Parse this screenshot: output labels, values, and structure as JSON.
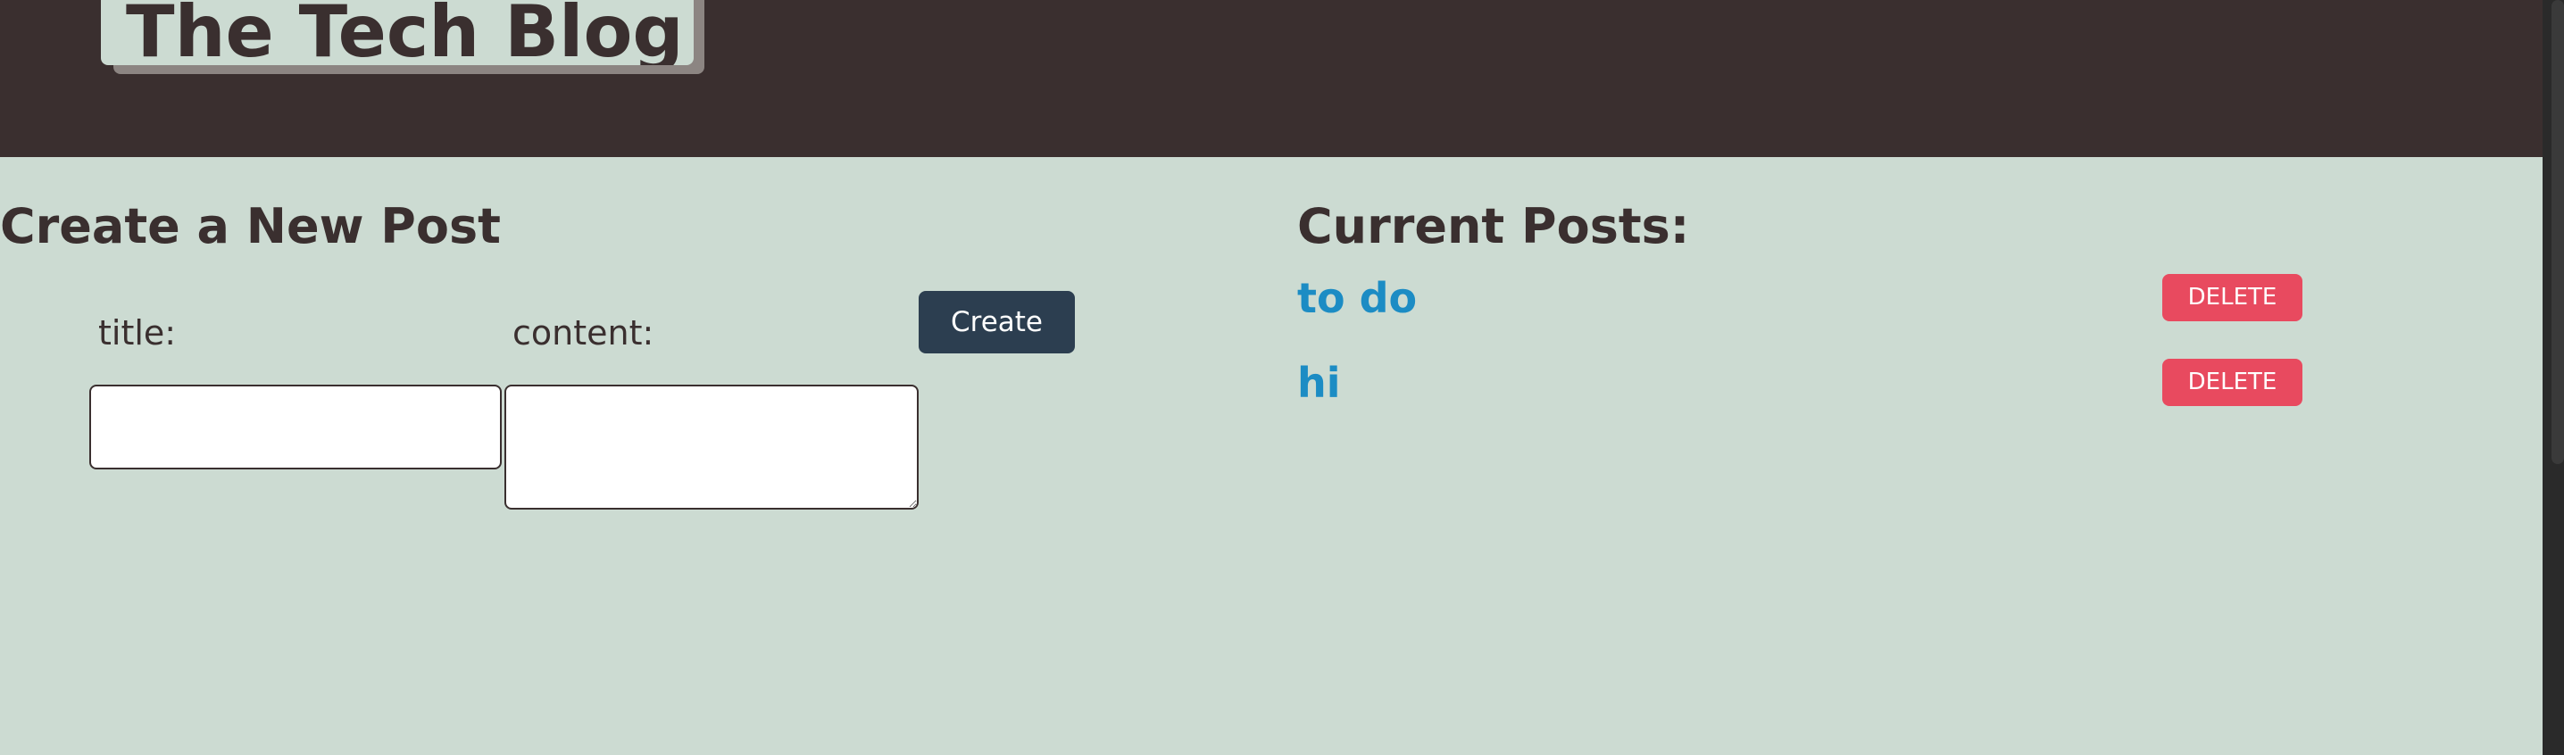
{
  "header": {
    "brand": "The Tech Blog"
  },
  "create_post": {
    "heading": "Create a New Post",
    "title_label": "title:",
    "title_value": "",
    "content_label": "content:",
    "content_value": "",
    "create_button_label": "Create"
  },
  "current_posts": {
    "heading": "Current Posts:",
    "items": [
      {
        "title": "to do",
        "delete_label": "DELETE"
      },
      {
        "title": "hi",
        "delete_label": "DELETE"
      }
    ]
  },
  "colors": {
    "header_bg": "#3a2f2f",
    "page_bg": "#ccdbd2",
    "create_button_bg": "#2c3e50",
    "delete_button_bg": "#e84a5f",
    "post_link": "#1c8cc4"
  }
}
